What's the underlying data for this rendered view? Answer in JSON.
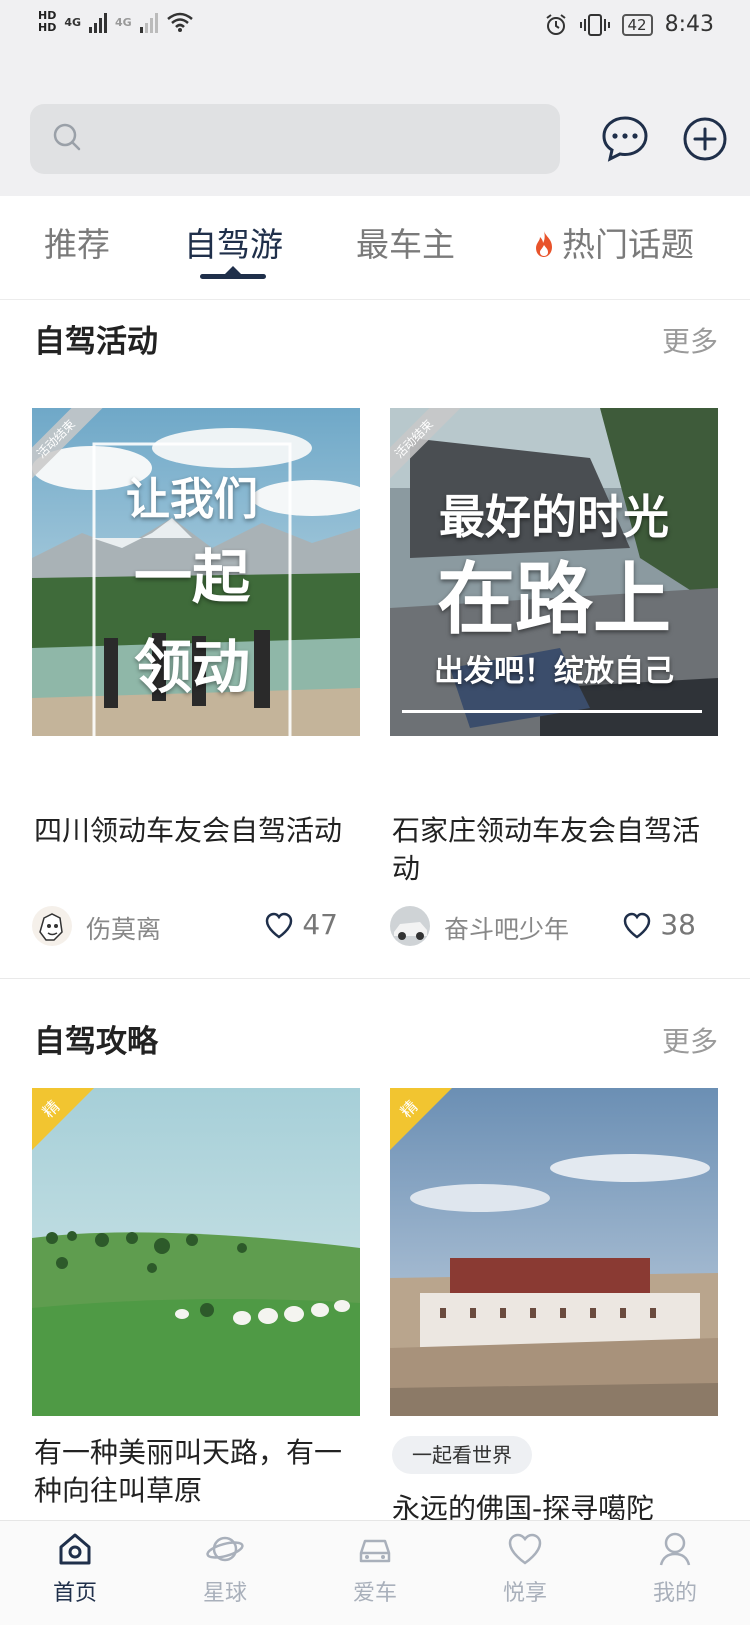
{
  "status_bar": {
    "hd1": "HD",
    "hd2": "HD",
    "net1": "4G",
    "net2": "4G",
    "battery": "42",
    "time": "8:43"
  },
  "search": {
    "placeholder": ""
  },
  "tabs": [
    {
      "label": "推荐",
      "active": false
    },
    {
      "label": "自驾游",
      "active": true
    },
    {
      "label": "最车主",
      "active": false
    },
    {
      "label": "热门话题",
      "active": false,
      "icon": "fire-icon"
    }
  ],
  "activities": {
    "title": "自驾活动",
    "more": "更多",
    "cards": [
      {
        "badge": "活动结束",
        "poster_lines": [
          "让我们",
          "一起",
          "领动"
        ],
        "title": "四川领动车友会自驾活动",
        "author": "伤莫离",
        "likes": "47"
      },
      {
        "badge": "活动结束",
        "poster_lines": [
          "最好的时光",
          "在路上",
          "出发吧！绽放自己"
        ],
        "title": "石家庄领动车友会自驾活动",
        "author": "奋斗吧少年",
        "likes": "38"
      }
    ]
  },
  "guides": {
    "title": "自驾攻略",
    "more": "更多",
    "cards": [
      {
        "badge": "精",
        "title": "有一种美丽叫天路，有一种向往叫草原",
        "tag": ""
      },
      {
        "badge": "精",
        "title": "永远的佛国-探寻噶陀",
        "tag": "一起看世界"
      }
    ]
  },
  "bottom_nav": [
    {
      "label": "首页",
      "icon": "home-icon",
      "active": true
    },
    {
      "label": "星球",
      "icon": "planet-icon",
      "active": false
    },
    {
      "label": "爱车",
      "icon": "car-icon",
      "active": false
    },
    {
      "label": "悦享",
      "icon": "heart-icon",
      "active": false
    },
    {
      "label": "我的",
      "icon": "profile-icon",
      "active": false
    }
  ],
  "colors": {
    "accent": "#1f2f4a",
    "inactive": "#a9b0bb",
    "header_bg": "#f0f0f2",
    "badge_gold": "#f2c530"
  }
}
